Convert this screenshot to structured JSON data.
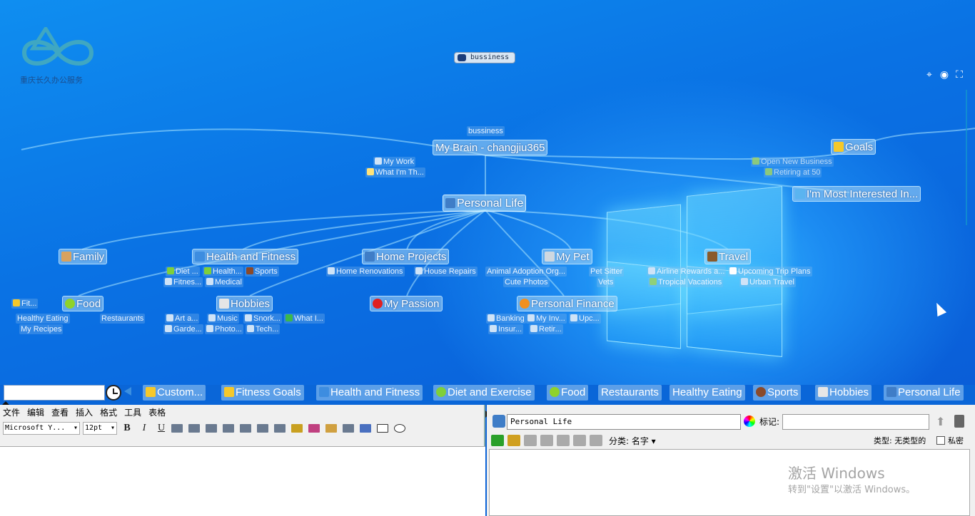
{
  "logo": {
    "text": "重庆长久办公服务"
  },
  "top_chip": "bussiness",
  "canvas_controls": [
    "locate-icon",
    "focus-icon",
    "fullscreen-icon"
  ],
  "mindmap": {
    "center": "Personal Life",
    "parent": "My Brain - changjiu365",
    "parent_top_tag": "bussiness",
    "parent_children": [
      "My Work",
      "What I'm Th..."
    ],
    "goals": "Goals",
    "goals_children": [
      "Open New Business",
      "Retiring at 50"
    ],
    "interested": "I'm Most Interested In...",
    "nodes": {
      "family": "Family",
      "health": "Health and Fitness",
      "home": "Home Projects",
      "pet": "My Pet",
      "travel": "Travel",
      "food": "Food",
      "hobbies": "Hobbies",
      "passion": "My Passion",
      "finance": "Personal Finance"
    },
    "health_children": [
      "Diet ...",
      "Health...",
      "Sports",
      "Fitnes...",
      "Medical"
    ],
    "home_children": [
      "Home Renovations",
      "House Repairs"
    ],
    "pet_children": [
      "Animal Adoption Org...",
      "Pet Sitter",
      "Cute Photos",
      "Vets"
    ],
    "travel_children": [
      "Airline Rewards a...",
      "Upcoming Trip Plans",
      "Tropical Vacations",
      "Urban Travel"
    ],
    "fit_tag": "Fit...",
    "food_children": [
      "Healthy Eating",
      "Restaurants",
      "My Recipes"
    ],
    "hobbies_children": [
      "Art a...",
      "Music",
      "Snork...",
      "What I...",
      "Garde...",
      "Photo...",
      "Tech..."
    ],
    "finance_children": [
      "Banking",
      "My Inv...",
      "Upc...",
      "Insur...",
      "Retir..."
    ]
  },
  "pins": [
    "Custom...",
    "Fitness Goals",
    "Health and Fitness",
    "Diet and Exercise",
    "Food",
    "Restaurants",
    "Healthy Eating",
    "Sports",
    "Hobbies",
    "Personal Life"
  ],
  "editor": {
    "menu": [
      "文件",
      "编辑",
      "查看",
      "插入",
      "格式",
      "工具",
      "表格"
    ],
    "font": "Microsoft Y...",
    "size": "12pt",
    "bold": "B",
    "italic": "I",
    "underline": "U"
  },
  "right": {
    "name": "Personal Life",
    "tag_label": "标记:",
    "category": "分类: 名字 ▾",
    "type": "类型: 无类型的",
    "private": "私密"
  },
  "watermark": {
    "line1": "激活 Windows",
    "line2": "转到\"设置\"以激活 Windows。"
  }
}
